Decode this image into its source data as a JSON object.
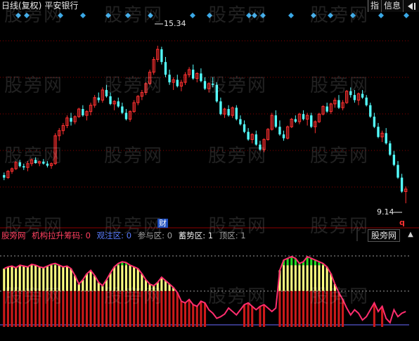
{
  "header": {
    "chart_mode": "日线(复权)",
    "stock_name": "平安银行",
    "button_index": "指",
    "button_info": "信息",
    "button_nav_icon": "panel-toggle-icon"
  },
  "annotations": {
    "high_label": "15.34",
    "low_label": "9.14",
    "finance_marker": "财",
    "q_marker": "q"
  },
  "indicator": {
    "name": "股旁网",
    "items": [
      {
        "text": "机构拉升筹码: 0",
        "color": "#ff4060"
      },
      {
        "text": "观注区: 0",
        "color": "#5a7dff"
      },
      {
        "text": "参与区: 0",
        "color": "#a0a0a0"
      },
      {
        "text": "蓄势区: 1",
        "color": "#e8e8e8"
      },
      {
        "text": "顶区: 1",
        "color": "#a0a0a0"
      }
    ],
    "panel_tab": "股旁网"
  },
  "watermark": "股旁网",
  "colors": {
    "up": "#ff3030",
    "down": "#54ffff",
    "grid": "#8b0000",
    "diamond": "#3aa8e6",
    "curve": "#ff2d6e",
    "green": "#22dd22",
    "yellow": "#ffff80",
    "red": "#cc1a1a",
    "baseline": "#6a6aff"
  },
  "chart_data": {
    "type": "candlestick",
    "price_range": [
      8.7,
      16.2
    ],
    "high": 15.34,
    "low": 9.14,
    "candles": [
      [
        10.25,
        10.35,
        10.05,
        10.15
      ],
      [
        10.15,
        10.45,
        10.1,
        10.4
      ],
      [
        10.4,
        10.55,
        10.3,
        10.5
      ],
      [
        10.5,
        10.8,
        10.45,
        10.75
      ],
      [
        10.75,
        10.85,
        10.55,
        10.6
      ],
      [
        10.6,
        10.7,
        10.45,
        10.55
      ],
      [
        10.55,
        10.8,
        10.4,
        10.7
      ],
      [
        10.7,
        10.9,
        10.6,
        10.85
      ],
      [
        10.85,
        10.95,
        10.7,
        10.72
      ],
      [
        10.72,
        10.82,
        10.6,
        10.78
      ],
      [
        10.78,
        10.88,
        10.66,
        10.7
      ],
      [
        10.7,
        10.8,
        10.55,
        10.62
      ],
      [
        10.62,
        10.75,
        10.5,
        10.7
      ],
      [
        10.7,
        11.9,
        10.65,
        11.8
      ],
      [
        11.8,
        12.1,
        11.6,
        12.0
      ],
      [
        12.0,
        12.3,
        11.85,
        12.2
      ],
      [
        12.2,
        12.6,
        12.1,
        12.5
      ],
      [
        12.5,
        12.7,
        12.2,
        12.35
      ],
      [
        12.35,
        12.6,
        12.25,
        12.55
      ],
      [
        12.55,
        12.9,
        12.5,
        12.85
      ],
      [
        12.85,
        13.0,
        12.55,
        12.6
      ],
      [
        12.6,
        12.8,
        12.4,
        12.75
      ],
      [
        12.75,
        13.1,
        12.6,
        13.0
      ],
      [
        13.0,
        13.4,
        12.9,
        13.3
      ],
      [
        13.3,
        13.5,
        13.1,
        13.2
      ],
      [
        13.2,
        13.7,
        13.1,
        13.6
      ],
      [
        13.6,
        13.8,
        13.3,
        13.35
      ],
      [
        13.35,
        13.5,
        13.0,
        13.05
      ],
      [
        13.05,
        13.2,
        12.8,
        13.15
      ],
      [
        13.15,
        13.3,
        12.9,
        12.95
      ],
      [
        12.95,
        13.1,
        12.65,
        12.7
      ],
      [
        12.7,
        12.85,
        12.4,
        12.45
      ],
      [
        12.45,
        12.8,
        12.35,
        12.75
      ],
      [
        12.75,
        13.2,
        12.7,
        13.1
      ],
      [
        13.1,
        13.4,
        13.0,
        13.35
      ],
      [
        13.35,
        13.6,
        13.2,
        13.5
      ],
      [
        13.5,
        13.9,
        13.4,
        13.85
      ],
      [
        13.85,
        14.4,
        13.8,
        14.3
      ],
      [
        14.3,
        14.9,
        14.2,
        14.8
      ],
      [
        14.8,
        15.34,
        14.7,
        15.2
      ],
      [
        15.2,
        15.3,
        14.6,
        14.7
      ],
      [
        14.7,
        14.9,
        14.1,
        14.2
      ],
      [
        14.2,
        14.4,
        13.8,
        13.9
      ],
      [
        13.9,
        14.1,
        13.6,
        14.0
      ],
      [
        14.0,
        14.2,
        13.7,
        13.75
      ],
      [
        13.75,
        14.0,
        13.55,
        13.9
      ],
      [
        13.9,
        14.3,
        13.8,
        14.2
      ],
      [
        14.2,
        14.5,
        14.1,
        14.4
      ],
      [
        14.4,
        14.6,
        14.0,
        14.05
      ],
      [
        14.05,
        14.3,
        13.9,
        14.25
      ],
      [
        14.25,
        14.45,
        13.9,
        13.95
      ],
      [
        13.95,
        14.1,
        13.6,
        13.65
      ],
      [
        13.65,
        13.9,
        13.5,
        13.85
      ],
      [
        13.85,
        14.1,
        13.7,
        13.8
      ],
      [
        13.8,
        13.9,
        13.1,
        13.15
      ],
      [
        13.15,
        13.3,
        12.6,
        12.65
      ],
      [
        12.65,
        12.9,
        12.5,
        12.85
      ],
      [
        12.85,
        13.0,
        12.55,
        12.6
      ],
      [
        12.6,
        12.95,
        12.5,
        12.9
      ],
      [
        12.9,
        13.0,
        12.4,
        12.45
      ],
      [
        12.45,
        12.6,
        12.2,
        12.25
      ],
      [
        12.25,
        12.4,
        11.9,
        11.95
      ],
      [
        11.95,
        12.1,
        11.6,
        11.65
      ],
      [
        11.65,
        11.9,
        11.5,
        11.85
      ],
      [
        11.85,
        12.0,
        11.4,
        11.45
      ],
      [
        11.45,
        11.6,
        11.2,
        11.25
      ],
      [
        11.25,
        11.7,
        11.15,
        11.65
      ],
      [
        11.65,
        12.1,
        11.6,
        12.05
      ],
      [
        12.05,
        12.7,
        12.0,
        12.6
      ],
      [
        12.6,
        12.8,
        12.1,
        12.15
      ],
      [
        12.15,
        12.4,
        11.8,
        11.85
      ],
      [
        11.85,
        12.0,
        11.6,
        11.7
      ],
      [
        11.7,
        12.2,
        11.65,
        12.15
      ],
      [
        12.15,
        12.5,
        12.1,
        12.45
      ],
      [
        12.45,
        12.6,
        12.3,
        12.35
      ],
      [
        12.35,
        12.7,
        12.25,
        12.65
      ],
      [
        12.65,
        12.8,
        12.4,
        12.45
      ],
      [
        12.45,
        12.7,
        12.2,
        12.6
      ],
      [
        12.6,
        12.7,
        12.1,
        12.15
      ],
      [
        12.15,
        12.4,
        11.9,
        12.35
      ],
      [
        12.35,
        12.7,
        12.3,
        12.65
      ],
      [
        12.65,
        13.0,
        12.6,
        12.95
      ],
      [
        12.95,
        13.1,
        12.7,
        12.75
      ],
      [
        12.75,
        13.1,
        12.65,
        13.05
      ],
      [
        13.05,
        13.3,
        12.9,
        13.2
      ],
      [
        13.2,
        13.4,
        12.85,
        12.9
      ],
      [
        12.9,
        13.2,
        12.8,
        13.1
      ],
      [
        13.1,
        13.6,
        13.05,
        13.55
      ],
      [
        13.55,
        13.7,
        13.3,
        13.4
      ],
      [
        13.4,
        13.6,
        13.1,
        13.2
      ],
      [
        13.2,
        13.5,
        13.0,
        13.45
      ],
      [
        13.45,
        13.6,
        13.25,
        13.3
      ],
      [
        13.3,
        13.4,
        12.95,
        13.0
      ],
      [
        13.0,
        13.1,
        12.5,
        12.55
      ],
      [
        12.55,
        12.7,
        12.1,
        12.15
      ],
      [
        12.15,
        12.3,
        11.7,
        11.75
      ],
      [
        11.75,
        12.0,
        11.55,
        11.9
      ],
      [
        11.9,
        12.1,
        11.45,
        11.5
      ],
      [
        11.5,
        11.6,
        11.0,
        11.05
      ],
      [
        11.05,
        11.2,
        10.6,
        10.65
      ],
      [
        10.65,
        10.8,
        10.1,
        10.15
      ],
      [
        10.15,
        10.3,
        9.55,
        9.6
      ],
      [
        9.6,
        9.8,
        9.14,
        9.7
      ]
    ],
    "indicator_series": [
      0.68,
      0.7,
      0.71,
      0.69,
      0.72,
      0.71,
      0.7,
      0.73,
      0.72,
      0.7,
      0.69,
      0.71,
      0.73,
      0.74,
      0.72,
      0.7,
      0.71,
      0.68,
      0.6,
      0.5,
      0.55,
      0.62,
      0.66,
      0.6,
      0.52,
      0.48,
      0.55,
      0.63,
      0.7,
      0.74,
      0.76,
      0.75,
      0.72,
      0.7,
      0.68,
      0.62,
      0.55,
      0.5,
      0.48,
      0.52,
      0.58,
      0.54,
      0.5,
      0.46,
      0.4,
      0.3,
      0.28,
      0.32,
      0.26,
      0.24,
      0.3,
      0.28,
      0.2,
      0.16,
      0.1,
      0.12,
      0.15,
      0.22,
      0.18,
      0.14,
      0.2,
      0.26,
      0.28,
      0.24,
      0.2,
      0.24,
      0.26,
      0.22,
      0.18,
      0.22,
      0.66,
      0.78,
      0.8,
      0.82,
      0.8,
      0.74,
      0.76,
      0.82,
      0.8,
      0.78,
      0.76,
      0.74,
      0.7,
      0.62,
      0.5,
      0.4,
      0.32,
      0.22,
      0.14,
      0.2,
      0.16,
      0.08,
      0.12,
      0.2,
      0.28,
      0.18,
      0.24,
      0.1,
      0.05,
      0.2,
      0.12,
      0.16,
      0.18
    ],
    "diamond_positions": [
      0.05,
      0.08,
      0.2,
      0.28,
      0.37,
      0.44,
      0.52,
      0.67,
      0.73,
      0.87,
      0.89,
      0.92,
      1.02,
      1.1,
      1.16,
      1.24,
      1.34,
      1.43
    ]
  }
}
